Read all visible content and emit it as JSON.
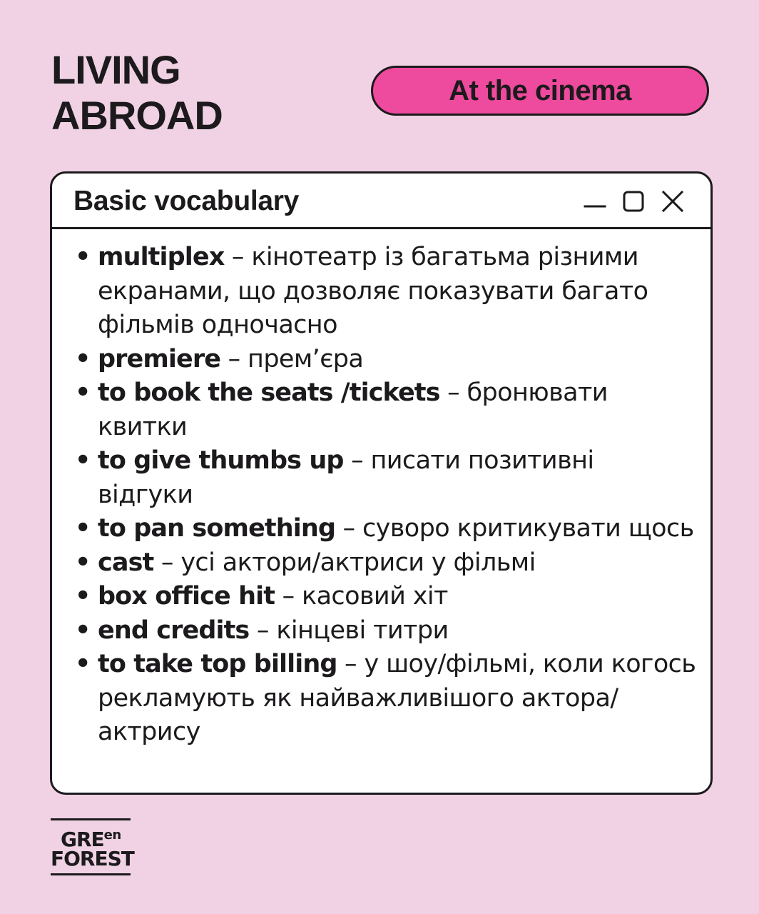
{
  "header": {
    "title_line1": "LIVING",
    "title_line2": "ABROAD",
    "topic": "At the cinema"
  },
  "window": {
    "title": "Basic vocabulary",
    "controls": [
      "minimize-icon",
      "maximize-icon",
      "close-icon"
    ]
  },
  "vocabulary": [
    {
      "term": "multiplex",
      "translation": "кінотеатр із багатьма різними екранами, що дозволяє показувати багато фільмів одночасно"
    },
    {
      "term": "premiere",
      "translation": "прем’єра"
    },
    {
      "term": "to book the seats /tickets",
      "translation": "бронювати квитки"
    },
    {
      "term": "to give thumbs up",
      "translation": "писати позитивні відгуки"
    },
    {
      "term": "to pan something",
      "translation": "суворо критикувати щось"
    },
    {
      "term": "cast",
      "translation": "усі актори/актриси у фільмі"
    },
    {
      "term": "box office hit",
      "translation": "касовий хіт"
    },
    {
      "term": "end credits",
      "translation": "кінцеві титри"
    },
    {
      "term": "to take top billing",
      "translation": "у шоу/фільмі, коли когось рекламують як найважливішого актора/актрису"
    }
  ],
  "logo": {
    "line1_main": "GRE",
    "line1_sup": "en",
    "line2": "FOREST"
  },
  "colors": {
    "background": "#f0d2e4",
    "accent_pill": "#ee4a9e",
    "ink": "#1c1a1c",
    "window_bg": "#ffffff"
  }
}
